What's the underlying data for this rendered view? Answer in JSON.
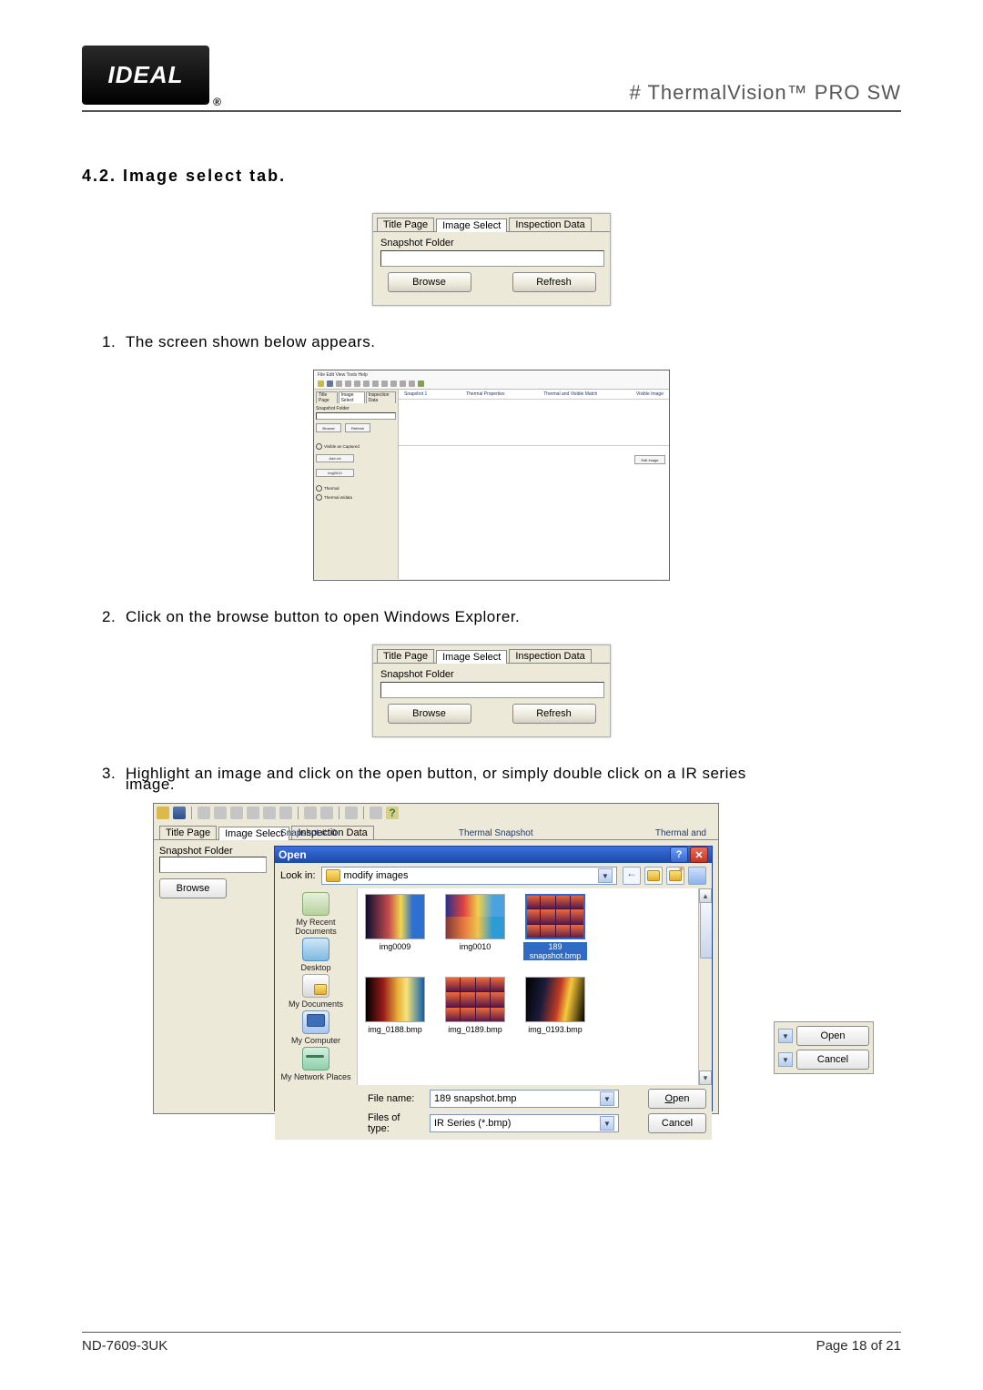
{
  "header": {
    "logo_text": "IDEAL",
    "title": "# ThermalVision™ PRO SW"
  },
  "section": {
    "title": "4.2. Image select tab."
  },
  "tabpanel": {
    "tabs": [
      "Title Page",
      "Image Select",
      "Inspection Data"
    ],
    "snapshot_label": "Snapshot Folder",
    "browse": "Browse",
    "refresh": "Refresh"
  },
  "steps": {
    "s1": "The screen shown below appears.",
    "s2": "Click on the browse button to open Windows Explorer.",
    "s3": "Highlight an image and click on the open button, or simply double click on a IR series",
    "s3b": "image."
  },
  "appwin": {
    "menubar": "File  Edit  View  Tools  Help",
    "minitabs": [
      "Title Page",
      "Image Select",
      "Inspection Data"
    ],
    "snapshot_label": "Snapshot Folder",
    "browse": "Browse",
    "refresh": "Refresh",
    "col_snapshot": "Snapshot  1",
    "col_prop": "Thermal Properties",
    "col_visible": "Thermal and Visible Match",
    "col_visimg": "Visible Image",
    "editimage": "Edit Image",
    "opt_visible": "Visible as Captured",
    "sel_addvis": "Add v/s",
    "sel_img": "img0010",
    "opt_thermal": "Thermal",
    "opt_thermalwd": "Thermal w/data"
  },
  "opendlg": {
    "title": "Open",
    "lookin_label": "Look in:",
    "lookin_value": "modify images",
    "places": {
      "recent": "My Recent Documents",
      "desktop": "Desktop",
      "docs": "My Documents",
      "computer": "My Computer",
      "network": "My Network Places"
    },
    "files": {
      "f1": "img0009",
      "f2": "img0010",
      "f3": "189 snapshot.bmp",
      "f4": "img_0188.bmp",
      "f5": "img_0189.bmp",
      "f6": "img_0193.bmp"
    },
    "filename_label": "File name:",
    "filename_value": "189 snapshot.bmp",
    "filetype_label": "Files of type:",
    "filetype_value": "IR Series (*.bmp)",
    "open": "Open",
    "cancel": "Cancel",
    "right_headers": {
      "snapshot": "Snapshot #:  0",
      "thermal": "Thermal Snapshot",
      "partial": "Thermal and"
    }
  },
  "minicrop": {
    "open": "Open",
    "cancel": "Cancel"
  },
  "footer": {
    "left": "ND-7609-3UK",
    "right": "Page 18 of 21"
  }
}
